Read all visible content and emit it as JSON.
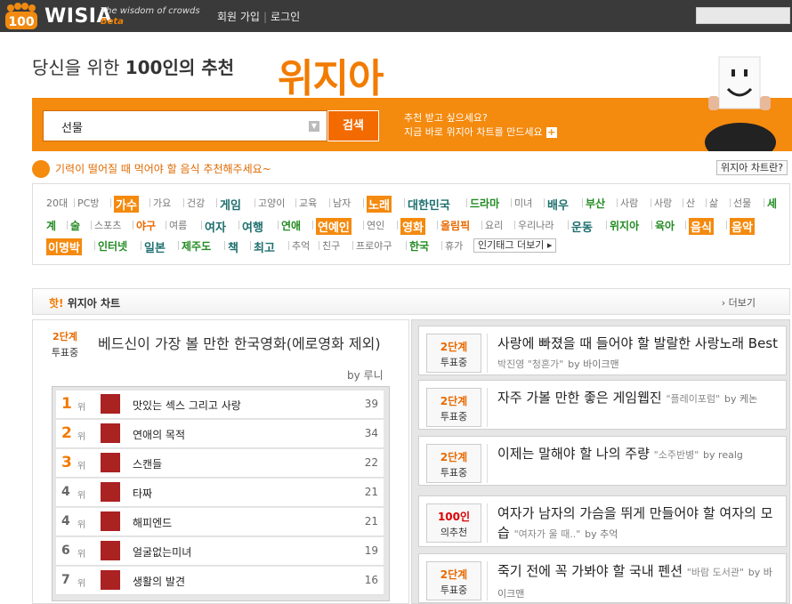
{
  "header": {
    "logo_badge": "100",
    "logo": "WISIA",
    "tagline": "The wisdom of crowds",
    "beta": "Beta",
    "links": [
      "회원 가입",
      "로그인"
    ]
  },
  "hero": {
    "title_pre": "당신을 위한 ",
    "title_bold": "100인의 추천",
    "brand": "위지아",
    "search_value": "선물",
    "search_button": "검색",
    "promo_line1": "추천 받고 싶으세요?",
    "promo_line2": "지금 바로 위지아 차트를 만드세요",
    "plus": "+"
  },
  "notice": {
    "text": "기력이 떨어질 때 먹어야 할 음식 추천해주세요~",
    "chart_question": "위지아 차트란?"
  },
  "tags": [
    {
      "t": "20대",
      "s": "s"
    },
    {
      "t": "PC방",
      "s": "s"
    },
    {
      "t": "가수",
      "s": "b"
    },
    {
      "t": "가요",
      "s": "s"
    },
    {
      "t": "건강",
      "s": "s"
    },
    {
      "t": "게임",
      "s": "m"
    },
    {
      "t": "고양이",
      "s": "s"
    },
    {
      "t": "교육",
      "s": "s"
    },
    {
      "t": "남자",
      "s": "s"
    },
    {
      "t": "노래",
      "s": "b"
    },
    {
      "t": "대한민국",
      "s": "m"
    },
    {
      "t": "드라마",
      "s": "g"
    },
    {
      "t": "미녀",
      "s": "s"
    },
    {
      "t": "배우",
      "s": "m"
    },
    {
      "t": "부산",
      "s": "g"
    },
    {
      "t": "사람",
      "s": "s"
    },
    {
      "t": "사랑",
      "s": "s"
    },
    {
      "t": "산",
      "s": "s"
    },
    {
      "t": "삶",
      "s": "s"
    },
    {
      "t": "선물",
      "s": "s"
    },
    {
      "t": "세",
      "s": "g"
    },
    {
      "t": "계",
      "s": "g"
    },
    {
      "t": "술",
      "s": "g"
    },
    {
      "t": "스포츠",
      "s": "s"
    },
    {
      "t": "야구",
      "s": "o"
    },
    {
      "t": "여름",
      "s": "s"
    },
    {
      "t": "여자",
      "s": "m"
    },
    {
      "t": "여행",
      "s": "m"
    },
    {
      "t": "연애",
      "s": "g"
    },
    {
      "t": "연예인",
      "s": "b"
    },
    {
      "t": "연인",
      "s": "s"
    },
    {
      "t": "영화",
      "s": "b"
    },
    {
      "t": "올림픽",
      "s": "o"
    },
    {
      "t": "요리",
      "s": "s"
    },
    {
      "t": "우리나라",
      "s": "s"
    },
    {
      "t": "운동",
      "s": "m"
    },
    {
      "t": "위지아",
      "s": "g"
    },
    {
      "t": "육아",
      "s": "g"
    },
    {
      "t": "음식",
      "s": "b"
    },
    {
      "t": "음악",
      "s": "b"
    },
    {
      "t": "이명박",
      "s": "b"
    },
    {
      "t": "인터넷",
      "s": "g"
    },
    {
      "t": "일본",
      "s": "m"
    },
    {
      "t": "제주도",
      "s": "g"
    },
    {
      "t": "책",
      "s": "m"
    },
    {
      "t": "최고",
      "s": "m"
    },
    {
      "t": "추억",
      "s": "s"
    },
    {
      "t": "친구",
      "s": "s"
    },
    {
      "t": "프로야구",
      "s": "s"
    },
    {
      "t": "한국",
      "s": "g"
    },
    {
      "t": "휴가",
      "s": "s"
    }
  ],
  "tags_more": "인기태그 더보기 ▸",
  "hot": {
    "hot_word": "핫!",
    "label": "위지아 차트",
    "more": "› 더보기"
  },
  "main_chart": {
    "stage": "2단계",
    "status": "투표중",
    "title": "베드신이 가장 볼 만한 한국영화(에로영화 제외)",
    "by": "by 루니",
    "rank_suffix": "위",
    "ranks": [
      {
        "rank": "1",
        "name": "맛있는 섹스 그리고 사랑",
        "count": "39"
      },
      {
        "rank": "2",
        "name": "연애의 목적",
        "count": "34"
      },
      {
        "rank": "3",
        "name": "스캔들",
        "count": "22"
      },
      {
        "rank": "4",
        "name": "타짜",
        "count": "21"
      },
      {
        "rank": "4",
        "name": "해피엔드",
        "count": "21"
      },
      {
        "rank": "6",
        "name": "얼굴없는미녀",
        "count": "19"
      },
      {
        "rank": "7",
        "name": "생활의 발견",
        "count": "16"
      }
    ]
  },
  "side_charts": [
    {
      "stage": "2단계",
      "status": "투표중",
      "title": "사랑에 빠졌을 때 들어야 할 발랄한 사랑노래 Best",
      "sub": "박진영 \"청혼가\"",
      "by": "by 바이크맨"
    },
    {
      "stage": "2단계",
      "status": "투표중",
      "title": "자주 가볼 만한 좋은 게임웹진",
      "sub": "\"플레이포럼\"",
      "by": "by 케논"
    },
    {
      "stage": "2단계",
      "status": "투표중",
      "title": "이제는 말해야 할 나의 주량",
      "sub": "\"소주반병\"",
      "by": "by realg"
    },
    {
      "stage": "100인",
      "status": "의추천",
      "title": "여자가 남자의 가슴을 뛰게 만들어야 할 여자의 모습",
      "sub": "\"여자가 울 때..\"",
      "by": "by 추억"
    },
    {
      "stage": "2단계",
      "status": "투표중",
      "title": "죽기 전에 꼭 가봐야 할 국내 펜션",
      "sub": "\"바람 도서관\"",
      "by": "by 바이크맨"
    }
  ]
}
